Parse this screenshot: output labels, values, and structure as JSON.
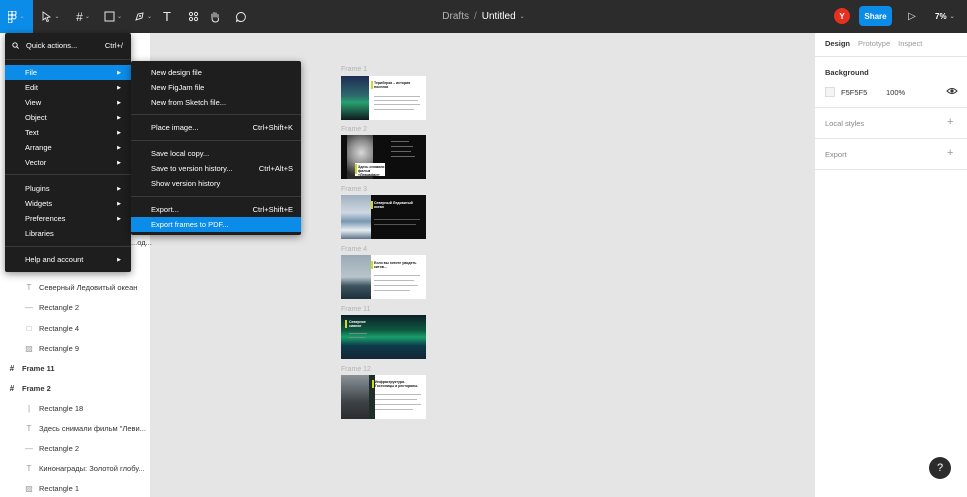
{
  "toolbar": {
    "tools": [
      {
        "name": "main-menu",
        "icon": "figma-logo-icon"
      },
      {
        "name": "move",
        "icon": "move-cursor-icon"
      },
      {
        "name": "frame",
        "icon": "frame-hash-icon"
      },
      {
        "name": "shape",
        "icon": "rectangle-icon"
      },
      {
        "name": "pen",
        "icon": "pen-icon"
      },
      {
        "name": "text",
        "icon": "text-icon",
        "glyph": "T"
      },
      {
        "name": "resources",
        "icon": "components-icon"
      },
      {
        "name": "hand",
        "icon": "hand-icon"
      },
      {
        "name": "comment",
        "icon": "comment-icon"
      }
    ],
    "breadcrumb_root": "Drafts",
    "breadcrumb_separator": "/",
    "file_name": "Untitled",
    "avatar_initial": "Y",
    "share_label": "Share",
    "zoom": "7%"
  },
  "main_menu": {
    "search_label": "Quick actions...",
    "search_shortcut": "Ctrl+/",
    "items": [
      {
        "label": "File",
        "submenu": true
      },
      {
        "label": "Edit",
        "submenu": true
      },
      {
        "label": "View",
        "submenu": true
      },
      {
        "label": "Object",
        "submenu": true
      },
      {
        "label": "Text",
        "submenu": true
      },
      {
        "label": "Arrange",
        "submenu": true
      },
      {
        "label": "Vector",
        "submenu": true
      },
      {
        "label": "Plugins",
        "submenu": true
      },
      {
        "label": "Widgets",
        "submenu": true
      },
      {
        "label": "Preferences",
        "submenu": true
      },
      {
        "label": "Libraries",
        "submenu": false
      },
      {
        "label": "Help and account",
        "submenu": true
      }
    ]
  },
  "file_menu": {
    "items": [
      {
        "label": "New design file",
        "shortcut": ""
      },
      {
        "label": "New FigJam file",
        "shortcut": ""
      },
      {
        "label": "New from Sketch file...",
        "shortcut": ""
      },
      {
        "label": "Place image...",
        "shortcut": "Ctrl+Shift+K"
      },
      {
        "label": "Save local copy...",
        "shortcut": ""
      },
      {
        "label": "Save to version history...",
        "shortcut": "Ctrl+Alt+S"
      },
      {
        "label": "Show version history",
        "shortcut": ""
      },
      {
        "label": "Export...",
        "shortcut": "Ctrl+Shift+E"
      },
      {
        "label": "Export frames to PDF...",
        "shortcut": ""
      }
    ]
  },
  "layers": [
    {
      "label": "...од...",
      "kind": "text"
    },
    {
      "label": "Северный Ледовитый океан",
      "kind": "text",
      "icon": "T"
    },
    {
      "label": "Rectangle 2",
      "kind": "line",
      "icon": "—"
    },
    {
      "label": "Rectangle 4",
      "kind": "rect",
      "icon": "□"
    },
    {
      "label": "Rectangle 9",
      "kind": "image",
      "icon": "▨"
    },
    {
      "label": "Frame 11",
      "kind": "frame",
      "icon": "#"
    },
    {
      "label": "Frame 2",
      "kind": "frame",
      "icon": "#"
    },
    {
      "label": "Rectangle 18",
      "kind": "line-v",
      "icon": "|"
    },
    {
      "label": "Здесь снимали фильм \"Леви...",
      "kind": "text",
      "icon": "T"
    },
    {
      "label": "Rectangle 2",
      "kind": "line",
      "icon": "—"
    },
    {
      "label": "Кинонаграды: Золотой глобу...",
      "kind": "text",
      "icon": "T"
    },
    {
      "label": "Rectangle 1",
      "kind": "image",
      "icon": "▨"
    }
  ],
  "canvas_frames": [
    {
      "label": "Frame 1",
      "text": "Териберка – история поселка",
      "dark_text": false
    },
    {
      "label": "Frame 2",
      "text": "Здесь снимали фильм «Левиафан»",
      "dark_text": false
    },
    {
      "label": "Frame 3",
      "text": "Северный Ледовитый океан",
      "dark_text": true
    },
    {
      "label": "Frame 4",
      "text": "Если вы хотите увидеть китов...",
      "dark_text": false
    },
    {
      "label": "Frame 11",
      "text": "Северное сияние",
      "dark_text": true
    },
    {
      "label": "Frame 12",
      "text": "Инфраструктура. Гостиницы и рестораны.",
      "dark_text": false
    }
  ],
  "right_panel": {
    "tabs": [
      "Design",
      "Prototype",
      "Inspect"
    ],
    "background_title": "Background",
    "background_hex": "F5F5F5",
    "background_opacity": "100%",
    "local_styles": "Local styles",
    "export": "Export",
    "help": "?"
  },
  "colors": {
    "accent": "#0c8ce9",
    "topbar": "#2c2c2c",
    "menu": "#1e1e1e",
    "avatar": "#e5311f",
    "canvas": "#e5e5e5",
    "slide_accent": "#cbdb2a"
  }
}
